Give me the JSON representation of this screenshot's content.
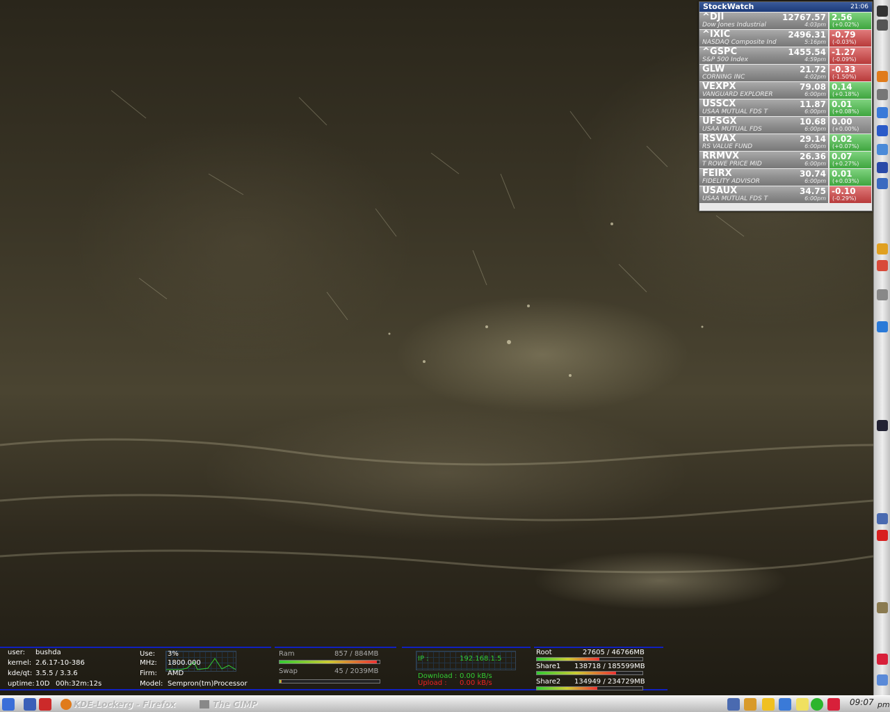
{
  "stockwatch": {
    "title": "StockWatch",
    "time": "21:06",
    "quotes": [
      {
        "symbol": "^DJI",
        "name": "Dow Jones Industrial",
        "price": "12767.57",
        "time": "4:03pm",
        "change": "2.56",
        "percent": "(+0.02%)",
        "direction": "up"
      },
      {
        "symbol": "^IXIC",
        "name": "NASDAQ Composite Ind",
        "price": "2496.31",
        "time": "5:16pm",
        "change": "-0.79",
        "percent": "(-0.03%)",
        "direction": "down"
      },
      {
        "symbol": "^GSPC",
        "name": "S&P 500 Index",
        "price": "1455.54",
        "time": "4:59pm",
        "change": "-1.27",
        "percent": "(-0.09%)",
        "direction": "down"
      },
      {
        "symbol": "GLW",
        "name": "CORNING INC",
        "price": "21.72",
        "time": "4:02pm",
        "change": "-0.33",
        "percent": "(-1.50%)",
        "direction": "down"
      },
      {
        "symbol": "VEXPX",
        "name": "VANGUARD EXPLORER",
        "price": "79.08",
        "time": "6:00pm",
        "change": "0.14",
        "percent": "(+0.18%)",
        "direction": "up"
      },
      {
        "symbol": "USSCX",
        "name": "USAA MUTUAL FDS T",
        "price": "11.87",
        "time": "6:00pm",
        "change": "0.01",
        "percent": "(+0.08%)",
        "direction": "up"
      },
      {
        "symbol": "UFSGX",
        "name": "USAA MUTUAL FDS",
        "price": "10.68",
        "time": "6:00pm",
        "change": "0.00",
        "percent": "(+0.00%)",
        "direction": "flat"
      },
      {
        "symbol": "RSVAX",
        "name": "RS VALUE FUND",
        "price": "29.14",
        "time": "6:00pm",
        "change": "0.02",
        "percent": "(+0.07%)",
        "direction": "up"
      },
      {
        "symbol": "RRMVX",
        "name": "T ROWE PRICE MID",
        "price": "26.36",
        "time": "6:00pm",
        "change": "0.07",
        "percent": "(+0.27%)",
        "direction": "up"
      },
      {
        "symbol": "FEIRX",
        "name": "FIDELITY ADVISOR",
        "price": "30.74",
        "time": "6:00pm",
        "change": "0.01",
        "percent": "(+0.03%)",
        "direction": "up"
      },
      {
        "symbol": "USAUX",
        "name": "USAA MUTUAL FDS T",
        "price": "34.75",
        "time": "6:00pm",
        "change": "-0.10",
        "percent": "(-0.29%)",
        "direction": "down"
      }
    ]
  },
  "sysinfo": {
    "user_label": "user:",
    "user": "bushda",
    "kernel_label": "kernel:",
    "kernel": "2.6.17-10-386",
    "kde_label": "kde/qt:",
    "kde": "3.5.5 / 3.3.6",
    "uptime_label": "uptime:",
    "uptime_days": "10D",
    "uptime_time": "00h:32m:12s"
  },
  "cpu": {
    "use_label": "Use:",
    "use": "3%",
    "mhz_label": "MHz:",
    "mhz": "1800.000",
    "firm_label": "Firm:",
    "firm": "AMD",
    "model_label": "Model:",
    "model": "Sempron(tm)Processor"
  },
  "memory": {
    "ram_label": "Ram",
    "ram": "857 / 884MB",
    "ram_fraction": 0.97,
    "swap_label": "Swap",
    "swap": "45 / 2039MB",
    "swap_fraction": 0.02
  },
  "network": {
    "ip_label": "IP :",
    "ip": "192.168.1.5",
    "download_label": "Download :",
    "download": "0.00 kB/s",
    "upload_label": "Upload :",
    "upload": "0.00 kB/s"
  },
  "disks": [
    {
      "name": "Root",
      "usage": "27605 / 46766MB",
      "fraction": 0.59
    },
    {
      "name": "Share1",
      "usage": "138718 / 185599MB",
      "fraction": 0.75
    },
    {
      "name": "Share2",
      "usage": "134949 / 234729MB",
      "fraction": 0.57
    }
  ],
  "taskbar": {
    "tasks": [
      {
        "label": "KDE-Lockerg - Firefox"
      },
      {
        "label": "The GIMP"
      }
    ],
    "clock": "09:07",
    "ampm": "pm"
  },
  "icons": {
    "right_bar": [
      "terminal-icon",
      "monitor-icon",
      "firefox-icon",
      "drive-icon",
      "network-icon",
      "globe-icon",
      "bug-icon",
      "desktop-icon",
      "compass-icon",
      "chrome-icon",
      "picasa-icon",
      "eye-icon",
      "earth-icon",
      "book-icon",
      "computer-icon",
      "close-icon",
      "photo-icon",
      "ruby-icon",
      "battery-icon"
    ],
    "launchers": [
      "kmenu-icon",
      "lock-icon",
      "logout-icon"
    ],
    "tray": [
      "volume-icon",
      "klipper-icon",
      "update-icon",
      "network-tray-icon",
      "notes-icon",
      "green-orb-icon",
      "ruby-tray-icon"
    ]
  }
}
